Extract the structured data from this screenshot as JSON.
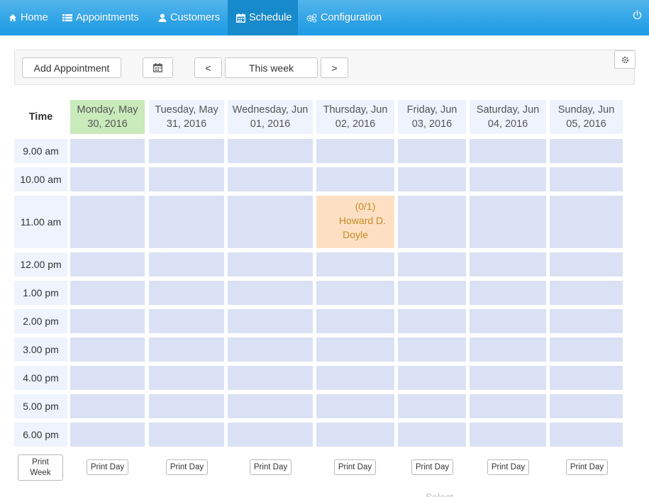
{
  "nav": {
    "items": [
      {
        "label": "Home",
        "icon": "home-icon"
      },
      {
        "label": "Appointments",
        "icon": "list-icon"
      },
      {
        "label": "Customers",
        "icon": "user-icon"
      },
      {
        "label": "Schedule",
        "icon": "calendar-icon",
        "active": true
      },
      {
        "label": "Configuration",
        "icon": "cogs-icon"
      }
    ],
    "power_icon": "power-icon"
  },
  "toolbar": {
    "add_label": "Add Appointment",
    "prev_label": "<",
    "week_label": "This week",
    "next_label": ">"
  },
  "schedule": {
    "time_header": "Time",
    "days": [
      {
        "label": "Monday, May 30, 2016",
        "today": true
      },
      {
        "label": "Tuesday, May 31, 2016"
      },
      {
        "label": "Wednesday, Jun 01, 2016"
      },
      {
        "label": "Thursday, Jun 02, 2016"
      },
      {
        "label": "Friday, Jun 03, 2016"
      },
      {
        "label": "Saturday, Jun 04, 2016"
      },
      {
        "label": "Sunday, Jun 05, 2016"
      }
    ],
    "times": [
      "9.00 am",
      "10.00 am",
      "11.00 am",
      "12.00 pm",
      "1.00 pm",
      "2.00 pm",
      "3.00 pm",
      "4.00 pm",
      "5.00 pm",
      "6.00 pm"
    ],
    "appointment": {
      "count": "(0/1)",
      "name_line1": "Howard D.",
      "name_line2": "Doyle"
    }
  },
  "print": {
    "week_line1": "Print",
    "week_line2": "Week",
    "day_label": "Print Day"
  },
  "below_text": "Select",
  "colors": {
    "navbar": "#2fa4e7",
    "active_tab": "#178acc",
    "today": "#c9eabb",
    "header": "#eef3fd",
    "cell": "#dbe1f4",
    "appointment": "#fde0c4"
  }
}
